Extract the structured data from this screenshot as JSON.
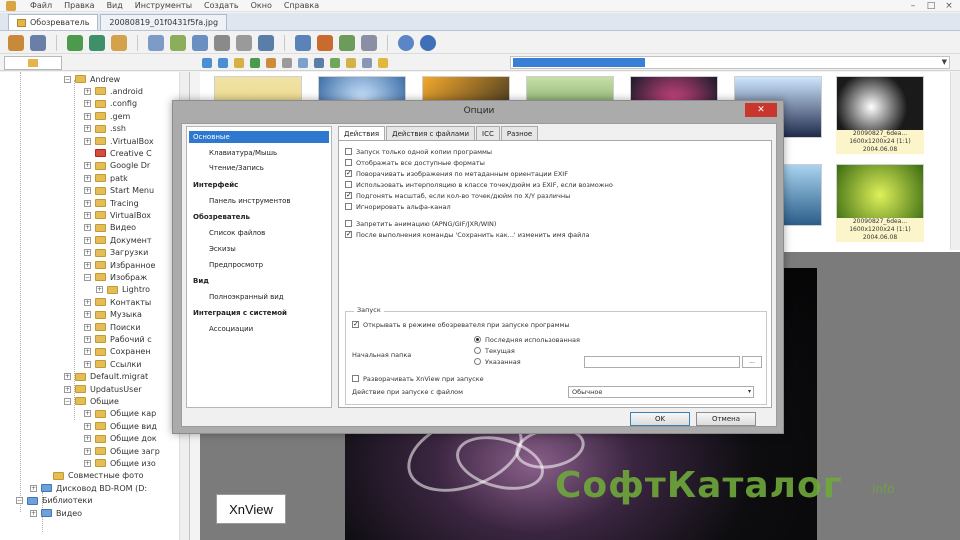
{
  "menu": {
    "items": [
      "Файл",
      "Правка",
      "Вид",
      "Инструменты",
      "Создать",
      "Окно",
      "Справка"
    ],
    "window_controls": [
      "–",
      "□",
      "×"
    ]
  },
  "tabs": [
    {
      "label": "Обозреватель",
      "active": true
    },
    {
      "label": "20080819_01f0431f5fa.jpg",
      "active": false
    }
  ],
  "tree": {
    "items": [
      {
        "label": "Andrew",
        "expander": "−"
      },
      {
        "label": ".android",
        "expander": "+"
      },
      {
        "label": ".config",
        "expander": "+"
      },
      {
        "label": ".gem",
        "expander": "+"
      },
      {
        "label": ".ssh",
        "expander": "+"
      },
      {
        "label": ".VirtualBox",
        "expander": "+"
      },
      {
        "label": "Creative C",
        "expander": ""
      },
      {
        "label": "Google Dr",
        "expander": "+"
      },
      {
        "label": "patk",
        "expander": "+"
      },
      {
        "label": "Start Menu",
        "expander": "+"
      },
      {
        "label": "Tracing",
        "expander": "+"
      },
      {
        "label": "VirtualBox",
        "expander": "+"
      },
      {
        "label": "Видео",
        "expander": "+"
      },
      {
        "label": "Документ",
        "expander": "+"
      },
      {
        "label": "Загрузки",
        "expander": "+"
      },
      {
        "label": "Избранное",
        "expander": "+"
      },
      {
        "label": "Изображ",
        "expander": "−"
      },
      {
        "label": "Lightro",
        "expander": "+"
      },
      {
        "label": "Контакты",
        "expander": "+"
      },
      {
        "label": "Музыка",
        "expander": "+"
      },
      {
        "label": "Поиски",
        "expander": "+"
      },
      {
        "label": "Рабочий с",
        "expander": "+"
      },
      {
        "label": "Сохранен",
        "expander": "+"
      },
      {
        "label": "Ссылки",
        "expander": "+"
      },
      {
        "label": "Default.migrat",
        "expander": "+"
      },
      {
        "label": "UpdatusUser",
        "expander": "+"
      },
      {
        "label": "Общие",
        "expander": "−"
      },
      {
        "label": "Общие кар",
        "expander": "+"
      },
      {
        "label": "Общие вид",
        "expander": "+"
      },
      {
        "label": "Общие док",
        "expander": "+"
      },
      {
        "label": "Общие загр",
        "expander": "+"
      },
      {
        "label": "Общие изо",
        "expander": "+"
      },
      {
        "label": "Совместные фото",
        "expander": ""
      },
      {
        "label": "Дисковод BD-ROM (D:",
        "expander": "+"
      },
      {
        "label": "Библиотеки",
        "expander": "−"
      },
      {
        "label": "Видео",
        "expander": "+"
      }
    ]
  },
  "thumbnails": [
    {
      "caption": "20090827_6dea...\n1600x1200x24 (1:1)\n2004.06.08"
    },
    {
      "caption": "20090827_6dea...\n1600x1200x24 (1:1)\n2004.06.08"
    }
  ],
  "dialog": {
    "title": "Опции",
    "close": "✕",
    "categories": [
      {
        "label": "Основные",
        "type": "selected"
      },
      {
        "label": "Клавиатура/Мышь",
        "type": "sub"
      },
      {
        "label": "Чтение/Запись",
        "type": "sub"
      },
      {
        "label": "Интерфейс",
        "type": "hdr"
      },
      {
        "label": "Панель инструментов",
        "type": "sub"
      },
      {
        "label": "Обозреватель",
        "type": "hdr"
      },
      {
        "label": "Список файлов",
        "type": "sub"
      },
      {
        "label": "Эскизы",
        "type": "sub"
      },
      {
        "label": "Предпросмотр",
        "type": "sub"
      },
      {
        "label": "Вид",
        "type": "hdr"
      },
      {
        "label": "Полноэкранный вид",
        "type": "sub"
      },
      {
        "label": "Интеграция с системой",
        "type": "hdr"
      },
      {
        "label": "Ассоциации",
        "type": "sub"
      }
    ],
    "tabs": [
      "Действия",
      "Действия с файлами",
      "ICC",
      "Разное"
    ],
    "options": [
      {
        "label": "Запуск только одной копии программы",
        "checked": false
      },
      {
        "label": "Отображать все доступные форматы",
        "checked": false
      },
      {
        "label": "Поворачивать изображения по метаданным ориентации EXIF",
        "checked": true
      },
      {
        "label": "Использовать интерполяцию в классе точек/дюйм из EXIF, если возможно",
        "checked": false
      },
      {
        "label": "Подгонять масштаб, если кол-во точек/дюйм по X/Y различны",
        "checked": true
      },
      {
        "label": "Игнорировать альфа-канал",
        "checked": false
      },
      {
        "label": "Запретить анимацию (APNG/GIF/JXR/WIN)",
        "checked": false
      },
      {
        "label": "После выполнения команды 'Сохранить как...' изменить имя файла",
        "checked": true
      }
    ],
    "startup": {
      "group_title": "Запуск",
      "open_in_browser": "Открывать в режиме обозревателя при запуске программы",
      "start_folder_label": "Начальная папка",
      "radios": [
        {
          "label": "Последняя использованная",
          "on": true
        },
        {
          "label": "Текущая",
          "on": false
        },
        {
          "label": "Указанная",
          "on": false
        }
      ],
      "browse_button": "...",
      "maximize": "Разворачивать XnView при запуске",
      "action_label": "Действие при запуске с файлом",
      "action_value": "Обычное",
      "combo_arrow": "▾"
    },
    "ok": "OK",
    "cancel": "Отмена"
  },
  "watermark": "СофтКаталог",
  "watermark_sub": "info",
  "caption": "XnView",
  "colors": {
    "selection_blue": "#2f78d0",
    "close_red": "#c8362c",
    "watermark_green": "#6fa83b",
    "folder_yellow": "#e6bd55"
  }
}
